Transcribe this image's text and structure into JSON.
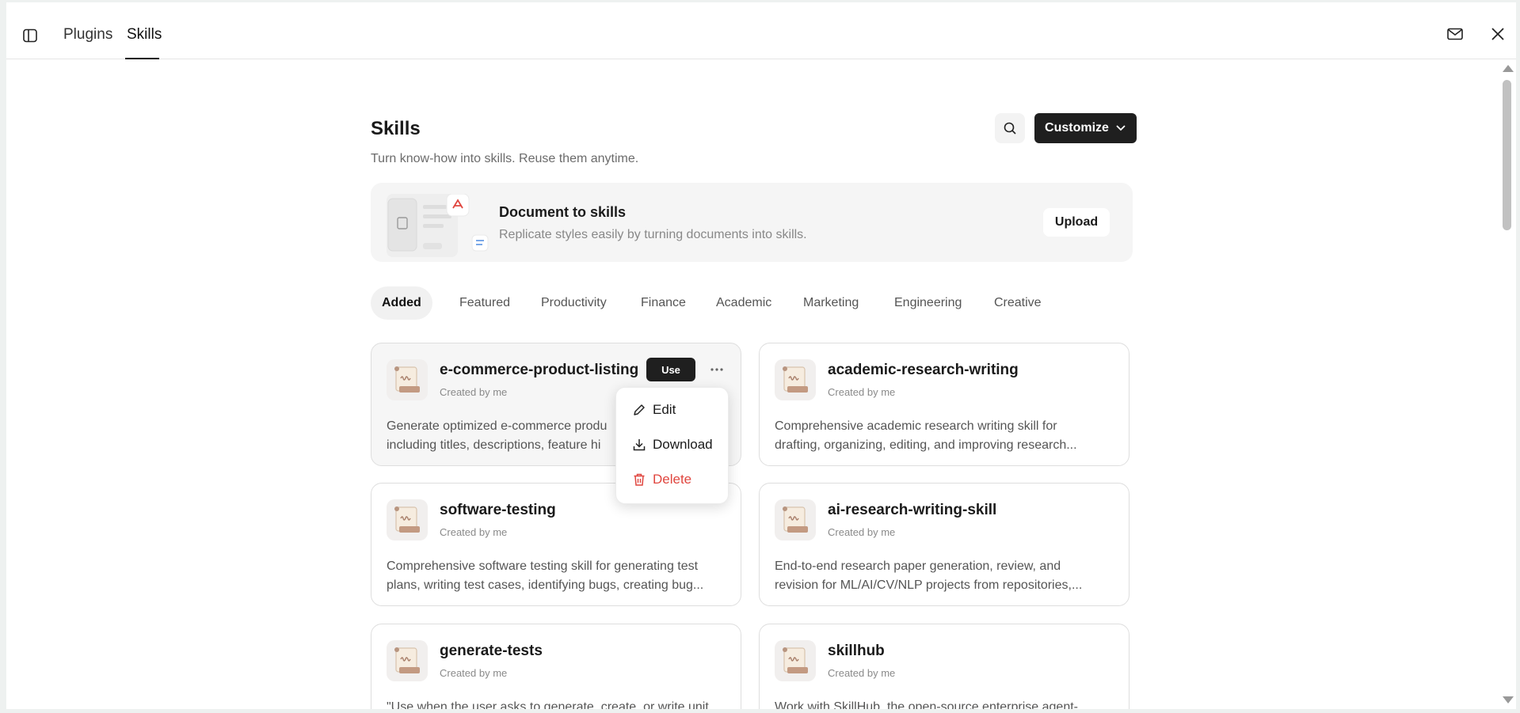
{
  "topbar": {
    "tabs": [
      {
        "label": "Plugins"
      },
      {
        "label": "Skills"
      }
    ]
  },
  "page": {
    "title": "Skills",
    "subtitle": "Turn know-how into skills. Reuse them anytime.",
    "customize_label": "Customize"
  },
  "banner": {
    "title": "Document to skills",
    "description": "Replicate styles easily by turning documents into skills.",
    "upload_label": "Upload"
  },
  "filters": [
    {
      "label": "Added"
    },
    {
      "label": "Featured"
    },
    {
      "label": "Productivity"
    },
    {
      "label": "Finance"
    },
    {
      "label": "Academic"
    },
    {
      "label": "Marketing"
    },
    {
      "label": "Engineering"
    },
    {
      "label": "Creative"
    }
  ],
  "cards": [
    {
      "name": "e-commerce-product-listing",
      "by": "Created by me",
      "desc1": "Generate optimized e-commerce produ",
      "desc2": "including titles, descriptions, feature hi",
      "use_label": "Use"
    },
    {
      "name": "academic-research-writing",
      "by": "Created by me",
      "desc1": "Comprehensive academic research writing skill for",
      "desc2": "drafting, organizing, editing, and improving research..."
    },
    {
      "name": "software-testing",
      "by": "Created by me",
      "desc1": "Comprehensive software testing skill for generating test",
      "desc2": "plans, writing test cases, identifying bugs, creating bug..."
    },
    {
      "name": "ai-research-writing-skill",
      "by": "Created by me",
      "desc1": "End-to-end research paper generation, review, and",
      "desc2": "revision for ML/AI/CV/NLP projects from repositories,..."
    },
    {
      "name": "generate-tests",
      "by": "Created by me",
      "desc1": "\"Use when the user asks to generate, create, or write unit",
      "desc2": ""
    },
    {
      "name": "skillhub",
      "by": "Created by me",
      "desc1": "Work with SkillHub, the open-source enterprise agent-",
      "desc2": ""
    }
  ],
  "menu": {
    "edit": "Edit",
    "download": "Download",
    "delete": "Delete"
  },
  "colors": {
    "accent_dark": "#1f1f1f",
    "danger": "#e0463f",
    "pdf_red": "#e0463f"
  }
}
